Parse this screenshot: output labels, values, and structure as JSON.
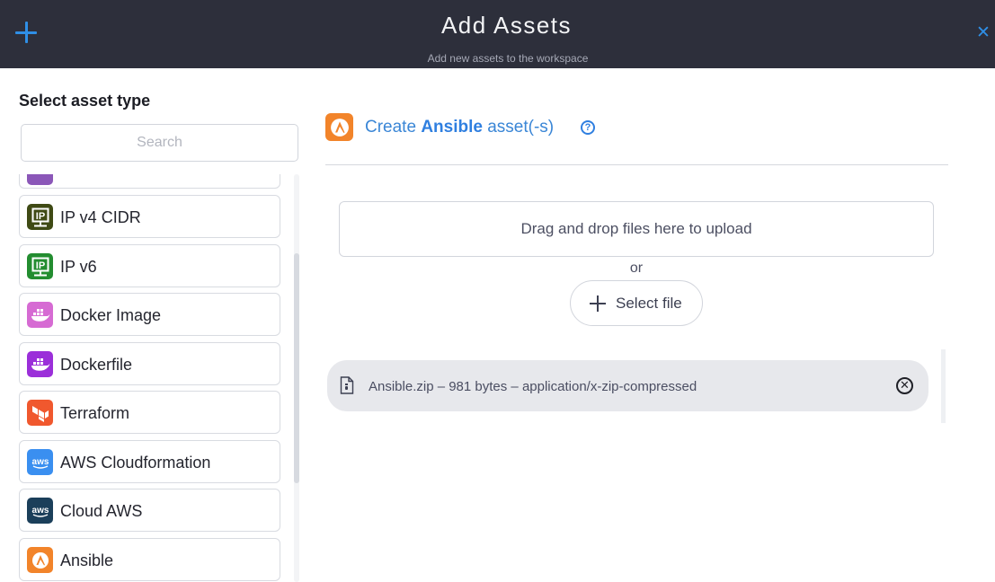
{
  "header": {
    "title": "Add Assets",
    "subtitle": "Add new assets to the workspace",
    "close_glyph": "✕"
  },
  "sidebar": {
    "title": "Select asset type",
    "search_placeholder": "Search",
    "items": [
      {
        "label": "",
        "icon": "purple-asset-icon",
        "color": "#8b57b8"
      },
      {
        "label": "IP v4 CIDR",
        "icon": "ip-icon",
        "color": "#3f4a14"
      },
      {
        "label": "IP v6",
        "icon": "ip-icon",
        "color": "#238d30"
      },
      {
        "label": "Docker Image",
        "icon": "docker-icon",
        "color": "#d66bd3"
      },
      {
        "label": "Dockerfile",
        "icon": "docker-icon",
        "color": "#9b2fd9"
      },
      {
        "label": "Terraform",
        "icon": "terraform-icon",
        "color": "#f0582e"
      },
      {
        "label": "AWS Cloudformation",
        "icon": "aws-icon",
        "color": "#3a8ff0"
      },
      {
        "label": "Cloud AWS",
        "icon": "aws-icon",
        "color": "#1b3f5a"
      },
      {
        "label": "Ansible",
        "icon": "ansible-icon",
        "color": "#f2842a"
      }
    ]
  },
  "main": {
    "heading_prefix": "Create ",
    "heading_asset": "Ansible",
    "heading_suffix": " asset(-s)",
    "help_glyph": "?",
    "dropzone_text": "Drag and drop files here to upload",
    "or_text": "or",
    "select_file_label": "Select file",
    "files": [
      {
        "name": "Ansible.zip",
        "size": "981 bytes",
        "mime": "application/x-zip-compressed",
        "display": "Ansible.zip  –  981 bytes  –  application/x-zip-compressed",
        "remove_glyph": "✕"
      }
    ]
  },
  "colors": {
    "header_bg": "#2d2f3b",
    "accent": "#2f7fe0",
    "ansible_orange": "#f2842a"
  }
}
